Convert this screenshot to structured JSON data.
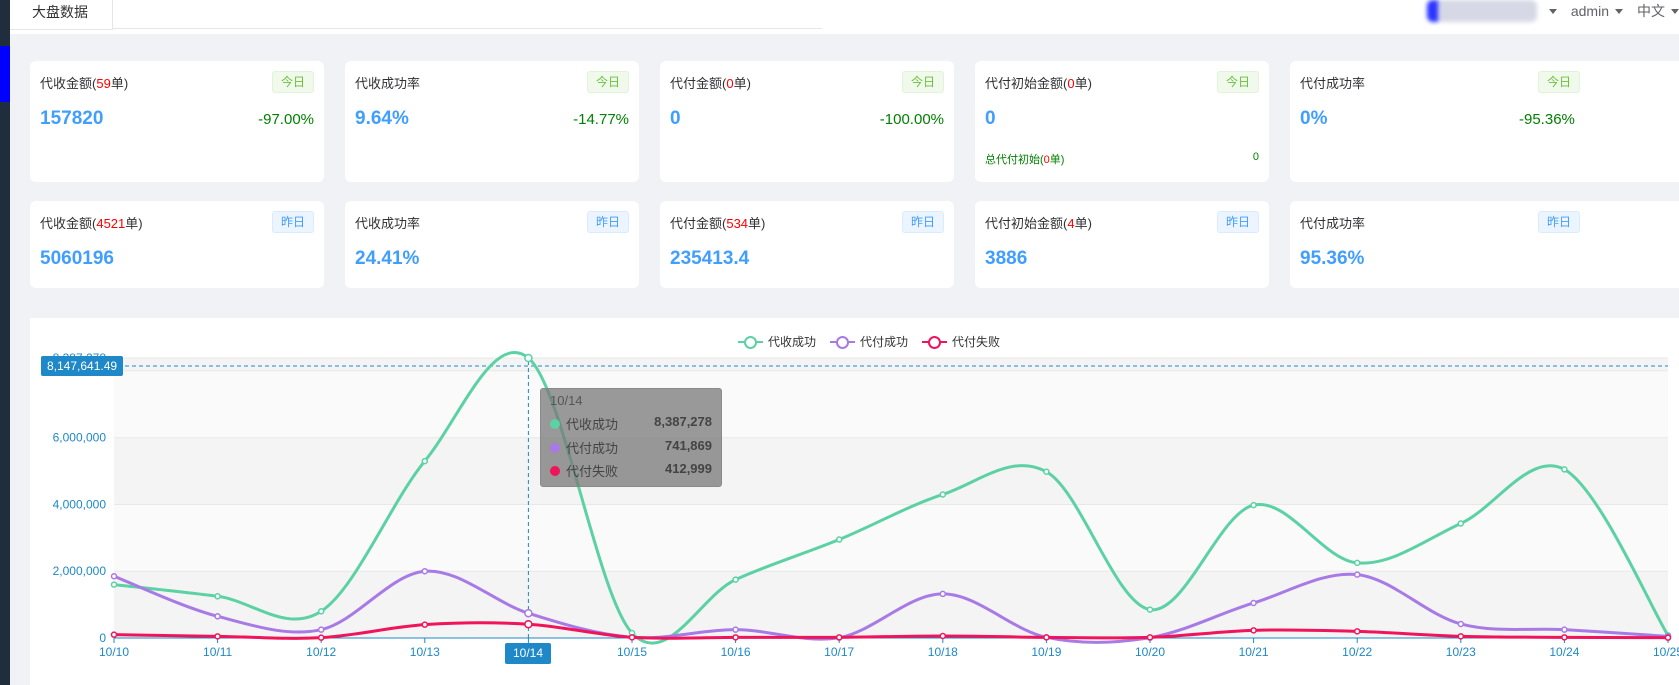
{
  "header": {
    "tab_label": "大盘数据",
    "user_name": "admin",
    "language": "中文"
  },
  "cards_today": [
    {
      "label": "代收金额(",
      "count": "59",
      "suffix": "单)",
      "badge": "今日",
      "value": "157820",
      "change": "-97.00%"
    },
    {
      "label": "代收成功率",
      "count": "",
      "suffix": "",
      "badge": "今日",
      "value": "9.64%",
      "change": "-14.77%"
    },
    {
      "label": "代付金额(",
      "count": "0",
      "suffix": "单)",
      "badge": "今日",
      "value": "0",
      "change": "-100.00%"
    },
    {
      "label": "代付初始金额(",
      "count": "0",
      "suffix": "单)",
      "badge": "今日",
      "value": "0",
      "change": "",
      "sub_label": "总代付初始(",
      "sub_count": "0",
      "sub_suffix": "单)",
      "sub_value": "0"
    },
    {
      "label": "代付成功率",
      "count": "",
      "suffix": "",
      "badge": "今日",
      "value": "0%",
      "change": "-95.36%"
    }
  ],
  "cards_yesterday": [
    {
      "label": "代收金额(",
      "count": "4521",
      "suffix": "单)",
      "badge": "昨日",
      "value": "5060196"
    },
    {
      "label": "代收成功率",
      "count": "",
      "suffix": "",
      "badge": "昨日",
      "value": "24.41%"
    },
    {
      "label": "代付金额(",
      "count": "534",
      "suffix": "单)",
      "badge": "昨日",
      "value": "235413.4"
    },
    {
      "label": "代付初始金额(",
      "count": "4",
      "suffix": "单)",
      "badge": "昨日",
      "value": "3886"
    },
    {
      "label": "代付成功率",
      "count": "",
      "suffix": "",
      "badge": "昨日",
      "value": "95.36%"
    }
  ],
  "colors": {
    "green": "#5bd1a4",
    "purple": "#a77ae6",
    "red": "#f0145a",
    "axis": "#1e88c8"
  },
  "tooltip": {
    "title": "10/14",
    "rows": [
      {
        "name": "代收成功",
        "value": "8,387,278",
        "color": "#5bd1a4"
      },
      {
        "name": "代付成功",
        "value": "741,869",
        "color": "#a77ae6"
      },
      {
        "name": "代付失败",
        "value": "412,999",
        "color": "#f0145a"
      }
    ]
  },
  "crosshair": {
    "y_value_label": "8,147,641.49",
    "x_value_label": "10/14"
  },
  "chart_data": {
    "type": "line",
    "categories": [
      "10/10",
      "10/11",
      "10/12",
      "10/13",
      "10/14",
      "10/15",
      "10/16",
      "10/17",
      "10/18",
      "10/19",
      "10/20",
      "10/21",
      "10/22",
      "10/23",
      "10/24",
      "10/25"
    ],
    "series": [
      {
        "name": "代收成功",
        "values": [
          1600000,
          1250000,
          800000,
          5300000,
          8387278,
          150000,
          1750000,
          2950000,
          4300000,
          4980000,
          850000,
          3980000,
          2250000,
          3430000,
          5050000,
          80000
        ]
      },
      {
        "name": "代付成功",
        "values": [
          1850000,
          650000,
          250000,
          2000000,
          741869,
          20000,
          250000,
          10000,
          1320000,
          20000,
          10000,
          1050000,
          1900000,
          420000,
          250000,
          50000
        ]
      },
      {
        "name": "代付失败",
        "values": [
          100000,
          50000,
          10000,
          400000,
          412999,
          20000,
          20000,
          20000,
          60000,
          20000,
          20000,
          230000,
          200000,
          50000,
          20000,
          10000
        ]
      }
    ],
    "yticks": [
      "0",
      "2,000,000",
      "4,000,000",
      "6,000,000"
    ],
    "ylim": [
      0,
      8387278
    ],
    "ymax_label": "8,387,278",
    "legend_position": "top-center",
    "grid": true
  }
}
